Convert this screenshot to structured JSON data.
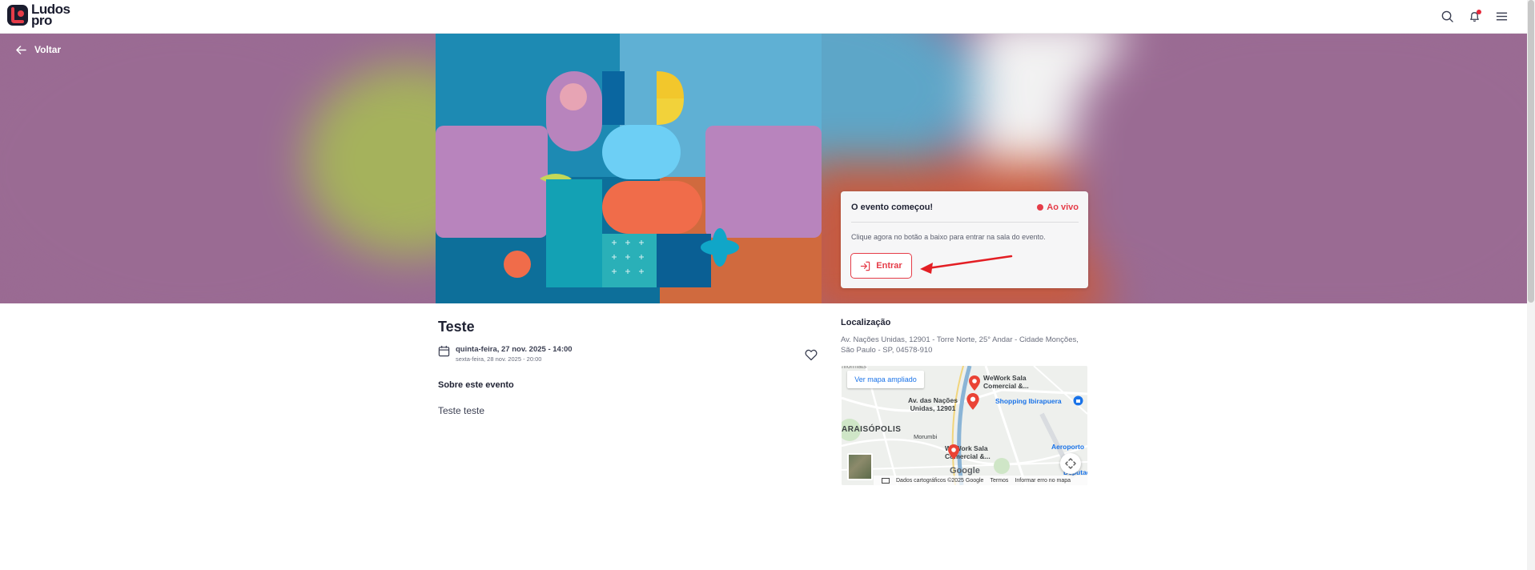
{
  "brand": {
    "line1": "Ludos",
    "line2": "pro"
  },
  "nav": {
    "back_label": "Voltar"
  },
  "event_card": {
    "title": "O evento começou!",
    "status": "Ao vivo",
    "description": "Clique agora no botão a baixo para entrar na sala do evento.",
    "button_label": "Entrar"
  },
  "event": {
    "title": "Teste",
    "date_start": "quinta-feira, 27 nov. 2025 - 14:00",
    "date_end": "sexta-feira, 28 nov. 2025 - 20:00",
    "about_heading": "Sobre este evento",
    "description": "Teste teste"
  },
  "location": {
    "heading": "Localização",
    "address": "Av. Nações Unidas, 12901 - Torre Norte, 25° Andar - Cidade Monções, São Paulo - SP, 04578-910"
  },
  "map": {
    "view_larger": "Ver mapa ampliado",
    "labels": {
      "wework_1": "WeWork Sala Comercial &...",
      "av_nacoes": "Av. das Nações Unidas, 12901",
      "shopping": "Shopping Ibirapuera",
      "paraisopolis": "ARAISÓPOLIS",
      "morumbi": "Morumbi",
      "wework_2": "WeWork Sala Comercial &...",
      "aeroporto": "Aeroporto",
      "deputado": "Deputad",
      "top_cut": "nformats"
    },
    "google": "Google",
    "footer_data": "Dados cartográficos ©2025 Google",
    "footer_terms": "Termos",
    "footer_report": "Informar erro no mapa"
  },
  "colors": {
    "accent": "#e53c48",
    "hero_purple": "#9a6b93"
  }
}
